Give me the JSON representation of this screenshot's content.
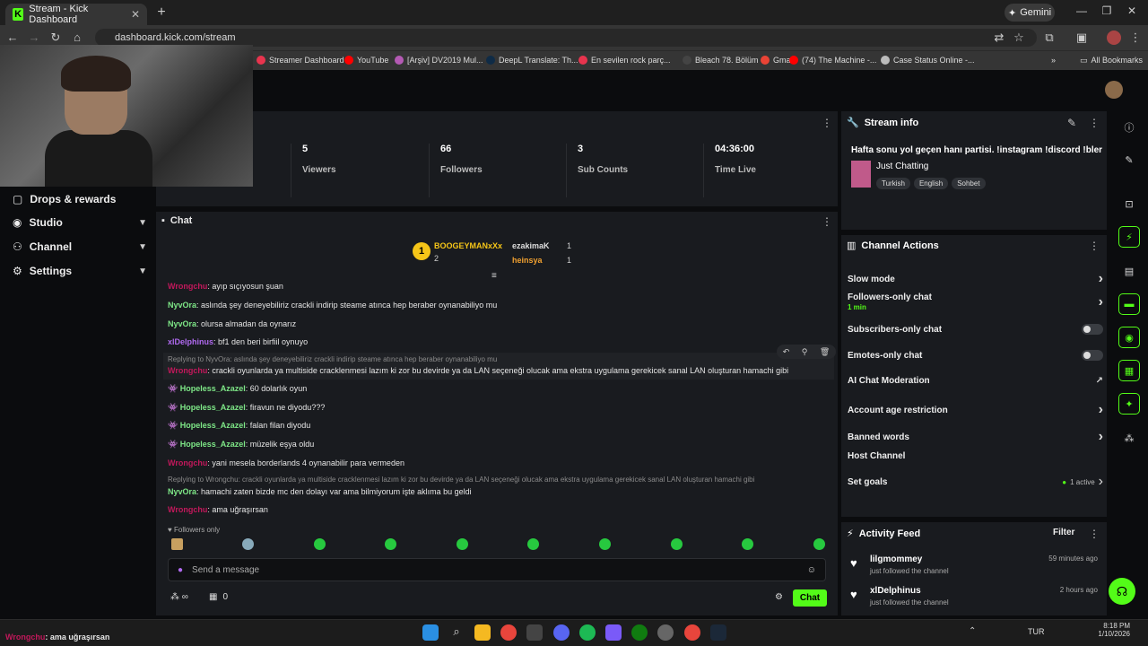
{
  "browser": {
    "tab_title": "Stream - Kick Dashboard",
    "url": "dashboard.kick.com/stream",
    "gemini_label": "Gemini",
    "bookmarks": [
      {
        "label": "Streamer Dashboard",
        "color": "#e8344e"
      },
      {
        "label": "YouTube",
        "color": "#ff0000"
      },
      {
        "label": "[Arşiv] DV2019 Mul...",
        "color": "#b45ab4"
      },
      {
        "label": "DeepL Translate: Th...",
        "color": "#0f2b46"
      },
      {
        "label": "En sevilen rock parç...",
        "color": "#e8344e"
      },
      {
        "label": "Bleach 78. Bölüm",
        "color": "#444444"
      },
      {
        "label": "Gmail",
        "color": "#ea4335"
      },
      {
        "label": "(74) The Machine -...",
        "color": "#ff0000"
      },
      {
        "label": "Case Status Online -...",
        "color": "#bbbbbb"
      }
    ],
    "all_bookmarks": "All Bookmarks"
  },
  "sidebar": {
    "items": [
      {
        "label": "Drops & rewards",
        "chevron": false
      },
      {
        "label": "Studio",
        "chevron": true
      },
      {
        "label": "Channel",
        "chevron": true
      },
      {
        "label": "Settings",
        "chevron": true
      }
    ]
  },
  "stats": [
    {
      "value": "5",
      "label": "Viewers"
    },
    {
      "value": "66",
      "label": "Followers"
    },
    {
      "value": "3",
      "label": "Sub Counts"
    },
    {
      "value": "04:36:00",
      "label": "Time Live"
    }
  ],
  "chat": {
    "title": "Chat",
    "leaderboard": {
      "first": {
        "name": "BOOGEYMANxXx",
        "count": "2"
      },
      "others": [
        {
          "name": "ezakimaK",
          "count": "1"
        },
        {
          "name": "heinsya",
          "count": "1"
        }
      ]
    },
    "messages": [
      {
        "user": "Wrongchu",
        "color": "#c2185b",
        "text": ": ayıp sıçıyosun şuan",
        "badge": false
      },
      {
        "user": "NyvOra",
        "color": "#7ee787",
        "text": ": aslında şey deneyebiliriz crackli indirip steame atınca hep beraber oynanabiliyo mu",
        "badge": false
      },
      {
        "user": "NyvOra",
        "color": "#7ee787",
        "text": ": olursa almadan da oynarız",
        "badge": false
      },
      {
        "user": "xlDelphinus",
        "color": "#b06af0",
        "text": ": bf1 den beri birfiil oynuyo",
        "badge": false
      },
      {
        "user": "Wrongchu",
        "color": "#c2185b",
        "text": ": crackli oyunlarda ya multiside cracklenmesi lazım ki zor bu devirde ya da LAN seçeneği olucak ama ekstra uygulama gerekicek sanal LAN oluşturan hamachi gibi",
        "badge": false,
        "reply": "Replying to NyvOra: aslında şey deneyebiliriz crackli indirip steame atınca hep beraber oynanabiliyo mu"
      },
      {
        "user": "Hopeless_Azazel",
        "color": "#7ee787",
        "text": ": 60 dolarlık oyun",
        "badge": true
      },
      {
        "user": "Hopeless_Azazel",
        "color": "#7ee787",
        "text": ": firavun ne diyodu???",
        "badge": true
      },
      {
        "user": "Hopeless_Azazel",
        "color": "#7ee787",
        "text": ": falan filan diyodu",
        "badge": true
      },
      {
        "user": "Hopeless_Azazel",
        "color": "#7ee787",
        "text": ": müzelik eşya oldu",
        "badge": true
      },
      {
        "user": "Wrongchu",
        "color": "#c2185b",
        "text": ": yani mesela borderlands 4 oynanabilir para vermeden",
        "badge": false
      },
      {
        "user": "NyvOra",
        "color": "#7ee787",
        "text": ": hamachi zaten bizde mc den dolayı var ama bilmiyorum işte aklıma bu geldi",
        "badge": false,
        "reply": "Replying to Wrongchu: crackli oyunlarda ya multiside cracklenmesi lazım ki zor bu devirde ya da LAN seçeneği olucak ama ekstra uygulama gerekicek sanal LAN oluşturan hamachi gibi"
      },
      {
        "user": "Wrongchu",
        "color": "#c2185b",
        "text": ": ama uğraşırsan",
        "badge": false
      }
    ],
    "followers_only": "Followers only",
    "placeholder": "Send a message",
    "sub_count": "0",
    "send_label": "Chat"
  },
  "stream_info": {
    "title": "Stream info",
    "stream_title": "Hafta sonu yol geçen hanı partisi. !instagram !discord !blerp",
    "category": "Just Chatting",
    "tags": [
      "Turkish",
      "English",
      "Sohbet"
    ]
  },
  "channel_actions": {
    "title": "Channel Actions",
    "items": [
      {
        "label": "Slow mode",
        "control": "chevron"
      },
      {
        "label": "Followers-only chat",
        "sub": "1 min",
        "control": "chevron"
      },
      {
        "label": "Subscribers-only chat",
        "control": "toggle"
      },
      {
        "label": "Emotes-only chat",
        "control": "toggle"
      },
      {
        "label": "AI Chat Moderation",
        "control": "external"
      },
      {
        "label": "Account age restriction",
        "control": "chevron"
      },
      {
        "label": "Banned words",
        "control": "chevron"
      },
      {
        "label": "Host Channel",
        "control": "none"
      },
      {
        "label": "Set goals",
        "control": "goals",
        "status": "1 active"
      }
    ]
  },
  "activity_feed": {
    "title": "Activity Feed",
    "filter_label": "Filter",
    "items": [
      {
        "user": "lilgmommey",
        "action": "just followed the channel",
        "time": "59 minutes ago"
      },
      {
        "user": "xlDelphinus",
        "action": "just followed the channel",
        "time": "2 hours ago"
      }
    ]
  },
  "overlay_bottom": {
    "user": "Wrongchu",
    "text": ": ama uğraşırsan"
  },
  "taskbar": {
    "lang": "TUR",
    "time": "8:18 PM",
    "date": "1/10/2026"
  },
  "colors": {
    "accent": "#53fc18",
    "panel": "#191b1f",
    "bg": "#0b0c0e"
  }
}
